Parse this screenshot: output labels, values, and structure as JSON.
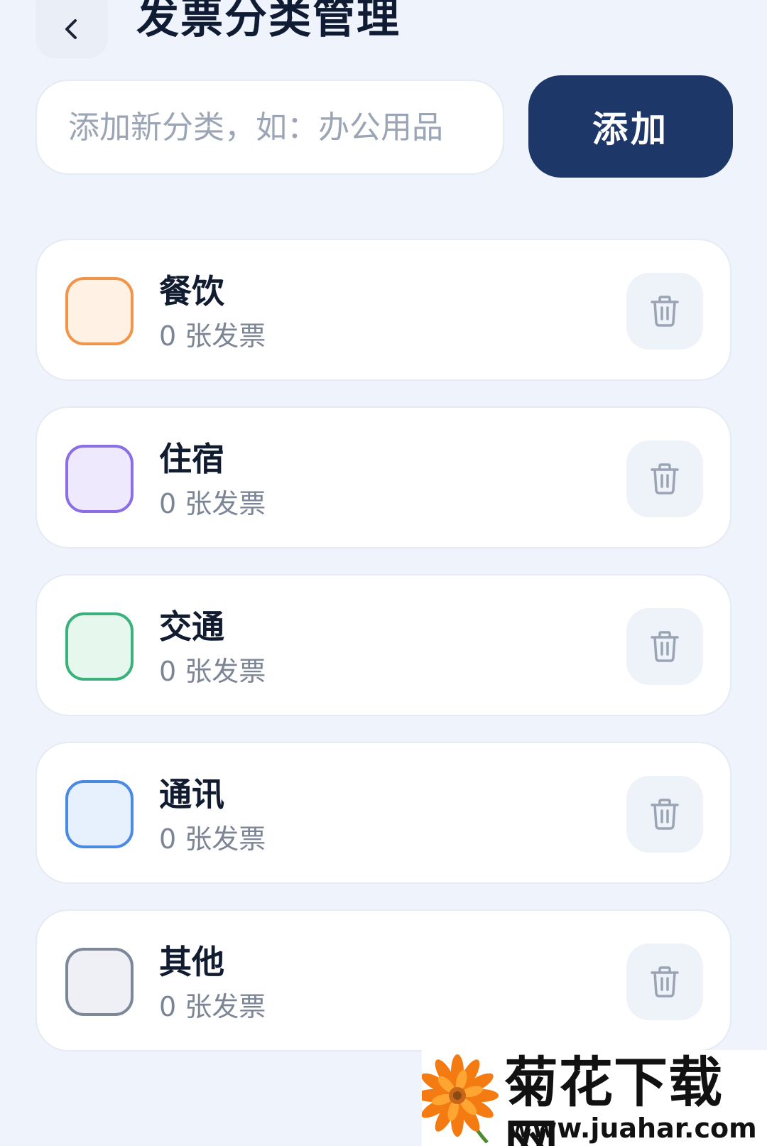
{
  "header": {
    "title": "发票分类管理",
    "back_icon": "chevron-left-icon"
  },
  "add_form": {
    "placeholder": "添加新分类，如：办公用品",
    "value": "",
    "button_label": "添加"
  },
  "categories": [
    {
      "name": "餐饮",
      "count_text": "0 张发票",
      "border_color": "#f0954a",
      "fill_color": "#fff1e4"
    },
    {
      "name": "住宿",
      "count_text": "0 张发票",
      "border_color": "#8b6ee6",
      "fill_color": "#efe9fd"
    },
    {
      "name": "交通",
      "count_text": "0 张发票",
      "border_color": "#3bb27c",
      "fill_color": "#e6f7ee"
    },
    {
      "name": "通讯",
      "count_text": "0 张发票",
      "border_color": "#4b8ae2",
      "fill_color": "#e7f0fd"
    },
    {
      "name": "其他",
      "count_text": "0 张发票",
      "border_color": "#7c8798",
      "fill_color": "#eef0f5"
    }
  ],
  "delete_icon": "trash-icon",
  "watermark": {
    "title": "菊花下载网",
    "url": "www.juahar.com"
  },
  "colors": {
    "background": "#eff3fb",
    "primary": "#1d3868",
    "card": "#ffffff"
  }
}
